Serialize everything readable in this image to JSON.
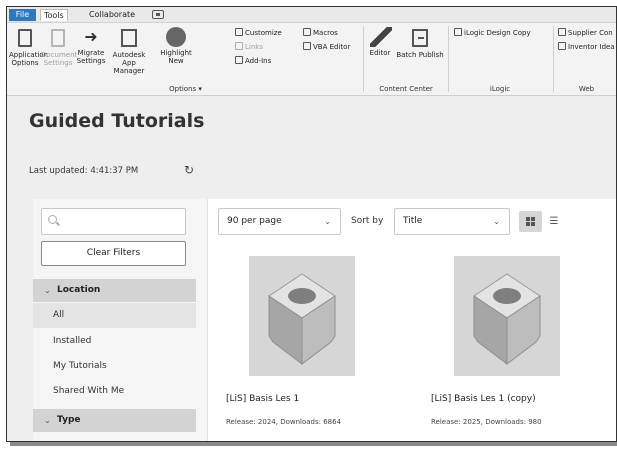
{
  "menubar": {
    "tabs": [
      "File",
      "Tools",
      "Collaborate"
    ],
    "active_tab": "Tools"
  },
  "ribbon": {
    "buttons": {
      "application_options": "Application Options",
      "document_settings": "Document Settings",
      "migrate_settings": "Migrate Settings",
      "autodesk_app_manager": "Autodesk App Manager",
      "highlight_new": "Highlight New",
      "editor": "Editor",
      "batch_publish": "Batch Publish"
    },
    "small": {
      "customize": "Customize",
      "macros": "Macros",
      "links": "Links",
      "vba_editor": "VBA Editor",
      "add_ins": "Add-Ins",
      "ilogic_design_copy": "iLogic Design Copy",
      "supplier_content": "Supplier Con",
      "inventor_ideas": "Inventor Idea"
    },
    "panels": {
      "options": "Options ▾",
      "content_center": "Content Center",
      "ilogic": "iLogic",
      "web": "Web"
    }
  },
  "page": {
    "title": "Guided Tutorials",
    "last_updated": "Last updated: 4:41:37 PM"
  },
  "filters": {
    "search_placeholder": "",
    "clear_label": "Clear Filters",
    "location_header": "Location",
    "location_items": [
      "All",
      "Installed",
      "My Tutorials",
      "Shared With Me"
    ],
    "type_header": "Type"
  },
  "toolbar": {
    "per_page": "90  per page",
    "sort_by_label": "Sort by",
    "sort_value": "Title"
  },
  "cards": [
    {
      "title": "[LiS] Basis Les 1",
      "meta": "Release: 2024, Downloads: 6864"
    },
    {
      "title": "[LiS] Basis Les 1 (copy)",
      "meta": "Release: 2025, Downloads: 980"
    }
  ],
  "colors": {
    "file_tab": "#2b78c4",
    "section_header": "#d3d3d3"
  }
}
